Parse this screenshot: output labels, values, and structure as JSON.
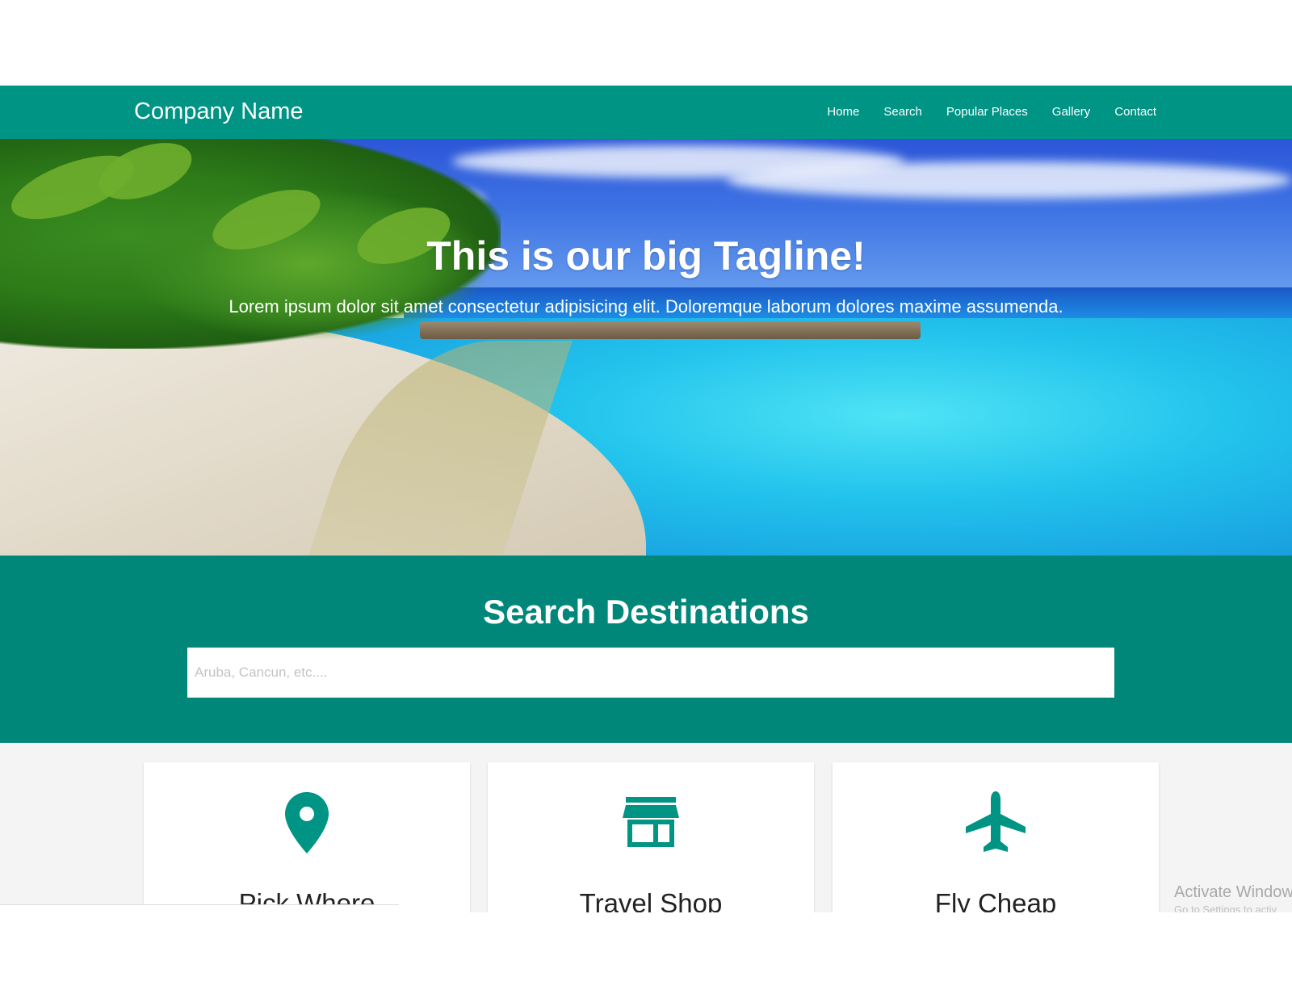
{
  "navbar": {
    "brand": "Company Name",
    "links": [
      "Home",
      "Search",
      "Popular Places",
      "Gallery",
      "Contact"
    ]
  },
  "hero": {
    "tagline": "This is our big Tagline!",
    "lead": "Lorem ipsum dolor sit amet consectetur adipisicing elit. Doloremque laborum dolores maxime assumenda."
  },
  "search": {
    "title": "Search Destinations",
    "placeholder": "Aruba, Cancun, etc...."
  },
  "cards": [
    {
      "title": "Pick Where",
      "icon": "map-marker-icon"
    },
    {
      "title": "Travel Shop",
      "icon": "store-icon"
    },
    {
      "title": "Fly Cheap",
      "icon": "airplane-icon"
    }
  ],
  "watermark": {
    "line1": "Activate Window",
    "line2": "Go to Settings to activ"
  },
  "colors": {
    "primary": "#009485",
    "search_band": "#00877a"
  }
}
